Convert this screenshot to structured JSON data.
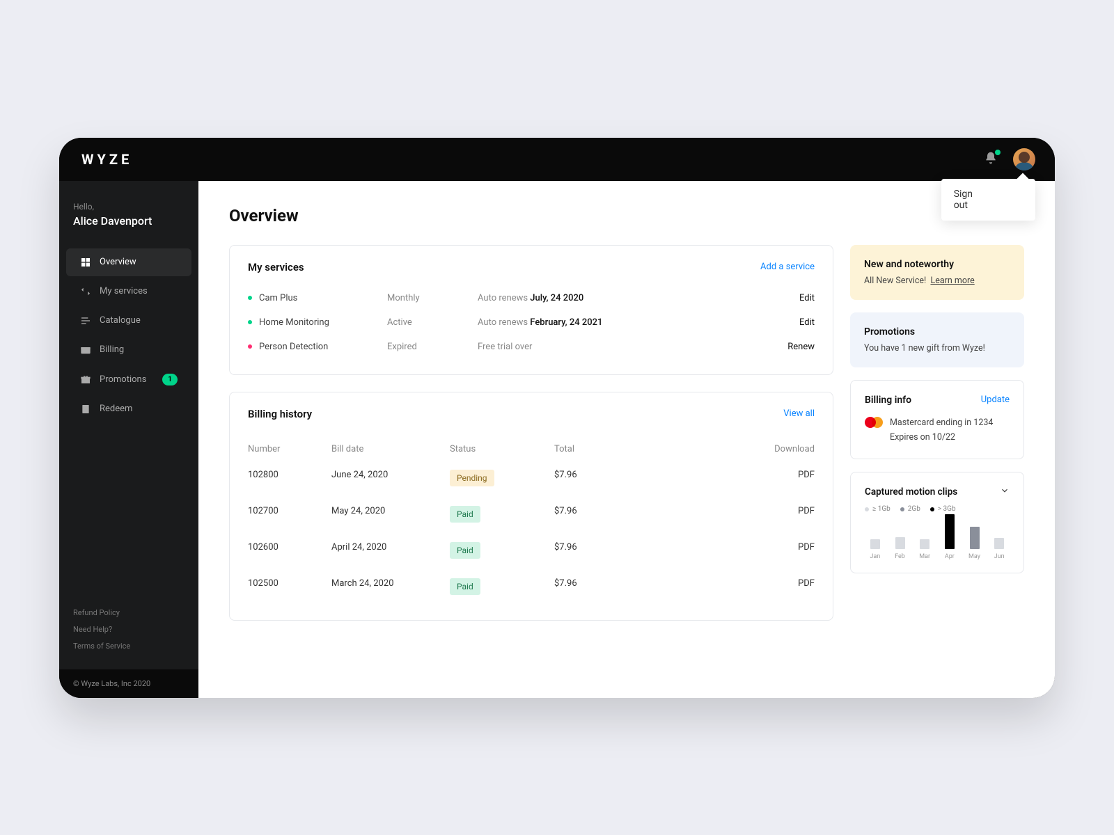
{
  "brand": "WYZE",
  "dropdown": {
    "signout": "Sign out"
  },
  "greeting": {
    "hello": "Hello,",
    "name": "Alice Davenport"
  },
  "nav": {
    "items": [
      {
        "label": "Overview",
        "active": true
      },
      {
        "label": "My services",
        "active": false
      },
      {
        "label": "Catalogue",
        "active": false
      },
      {
        "label": "Billing",
        "active": false
      },
      {
        "label": "Promotions",
        "active": false,
        "badge": "1"
      },
      {
        "label": "Redeem",
        "active": false
      }
    ]
  },
  "footer_links": [
    "Refund Policy",
    "Need Help?",
    "Terms of Service"
  ],
  "copyright": "© Wyze Labs, Inc 2020",
  "page_title": "Overview",
  "services": {
    "title": "My services",
    "add": "Add a service",
    "rows": [
      {
        "name": "Cam Plus",
        "dot": "teal",
        "status": "Monthly",
        "renew_prefix": "Auto renews ",
        "renew_date": "July, 24 2020",
        "action": "Edit"
      },
      {
        "name": "Home Monitoring",
        "dot": "teal",
        "status": "Active",
        "renew_prefix": "Auto renews ",
        "renew_date": "February, 24 2021",
        "action": "Edit"
      },
      {
        "name": "Person Detection",
        "dot": "pink",
        "status": "Expired",
        "renew_prefix": "Free trial over",
        "renew_date": "",
        "action": "Renew"
      }
    ]
  },
  "billing": {
    "title": "Billing history",
    "view_all": "View all",
    "headers": {
      "number": "Number",
      "date": "Bill date",
      "status": "Status",
      "total": "Total",
      "download": "Download"
    },
    "rows": [
      {
        "number": "102800",
        "date": "June 24, 2020",
        "status": "Pending",
        "status_class": "pending",
        "total": "$7.96",
        "download": "PDF"
      },
      {
        "number": "102700",
        "date": "May 24, 2020",
        "status": "Paid",
        "status_class": "paid",
        "total": "$7.96",
        "download": "PDF"
      },
      {
        "number": "102600",
        "date": "April 24, 2020",
        "status": "Paid",
        "status_class": "paid",
        "total": "$7.96",
        "download": "PDF"
      },
      {
        "number": "102500",
        "date": "March 24, 2020",
        "status": "Paid",
        "status_class": "paid",
        "total": "$7.96",
        "download": "PDF"
      }
    ]
  },
  "noteworthy": {
    "title": "New and noteworthy",
    "text": "All New Service!",
    "learn": "Learn more"
  },
  "promotions_card": {
    "title": "Promotions",
    "text": "You have 1 new gift from Wyze!"
  },
  "billing_info": {
    "title": "Billing info",
    "update": "Update",
    "line1": "Mastercard ending in 1234",
    "line2": "Expires on 10/22"
  },
  "chart_data": {
    "type": "bar",
    "title": "Captured motion clips",
    "legend": [
      "≥ 1Gb",
      "2Gb",
      "> 3Gb"
    ],
    "categories": [
      "Jan",
      "Feb",
      "Mar",
      "Apr",
      "May",
      "Jun"
    ],
    "values": [
      0.6,
      0.9,
      0.6,
      3.5,
      2.1,
      0.8
    ],
    "colors": [
      "#d8dbe0",
      "#d8dbe0",
      "#d8dbe0",
      "#000",
      "#8a8f9a",
      "#d8dbe0"
    ]
  }
}
